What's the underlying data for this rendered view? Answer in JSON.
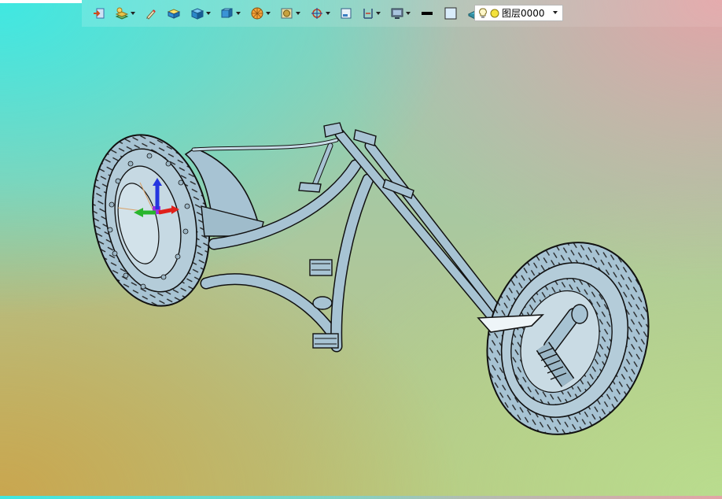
{
  "toolbar": {
    "buttons": [
      {
        "name": "import-icon",
        "dropdown": false
      },
      {
        "name": "layer-manager-icon",
        "dropdown": true
      },
      {
        "name": "edit-tool-icon",
        "dropdown": false
      },
      {
        "name": "box-shaded-icon",
        "dropdown": false
      },
      {
        "name": "solid-cube-icon",
        "dropdown": true
      },
      {
        "name": "view-cube-icon",
        "dropdown": true
      },
      {
        "name": "render-mode-icon",
        "dropdown": true
      },
      {
        "name": "texture-icon",
        "dropdown": true
      },
      {
        "name": "snap-target-icon",
        "dropdown": true
      },
      {
        "name": "panel-icon",
        "dropdown": false
      },
      {
        "name": "measure-icon",
        "dropdown": true
      },
      {
        "name": "display-icon",
        "dropdown": true
      },
      {
        "name": "line-color-icon",
        "dropdown": false
      },
      {
        "name": "fill-color-icon",
        "dropdown": false
      },
      {
        "name": "material-icon",
        "dropdown": true
      }
    ],
    "layer": {
      "name": "图层0000",
      "bulb_icon": "lightbulb-icon",
      "state_icon": "layer-state-icon"
    }
  },
  "colors": {
    "model_fill": "#a7c3d3",
    "model_line": "#111111",
    "axis_x": "#e0201a",
    "axis_y": "#28b52c",
    "axis_z": "#2536e0"
  }
}
